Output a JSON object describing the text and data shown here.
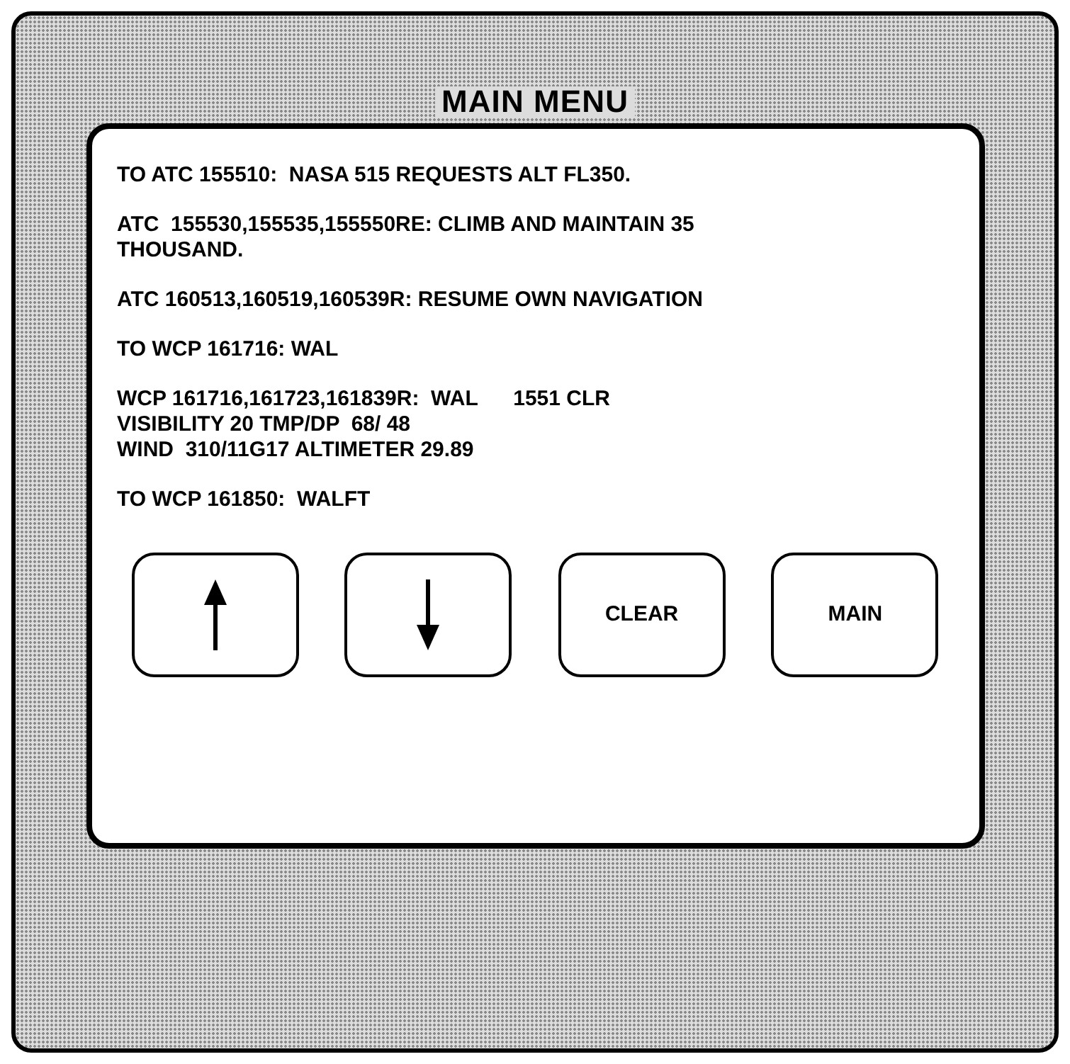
{
  "title": "MAIN MENU",
  "messages": [
    {
      "lines": [
        "TO ATC 155510:  NASA 515 REQUESTS ALT FL350."
      ]
    },
    {
      "lines": [
        "ATC  155530,155535,155550RE: CLIMB AND MAINTAIN 35",
        "THOUSAND."
      ]
    },
    {
      "lines": [
        "ATC 160513,160519,160539R: RESUME OWN NAVIGATION"
      ]
    },
    {
      "lines": [
        "TO WCP 161716: WAL"
      ]
    },
    {
      "lines": [
        "WCP 161716,161723,161839R:  WAL      1551 CLR",
        "VISIBILITY 20 TMP/DP  68/ 48",
        "WIND  310/11G17 ALTIMETER 29.89"
      ]
    },
    {
      "lines": [
        "TO WCP 161850:  WALFT"
      ]
    }
  ],
  "buttons": [
    {
      "kind": "up"
    },
    {
      "kind": "down"
    },
    {
      "kind": "text",
      "label": "CLEAR"
    },
    {
      "kind": "text",
      "label": "MAIN"
    }
  ]
}
